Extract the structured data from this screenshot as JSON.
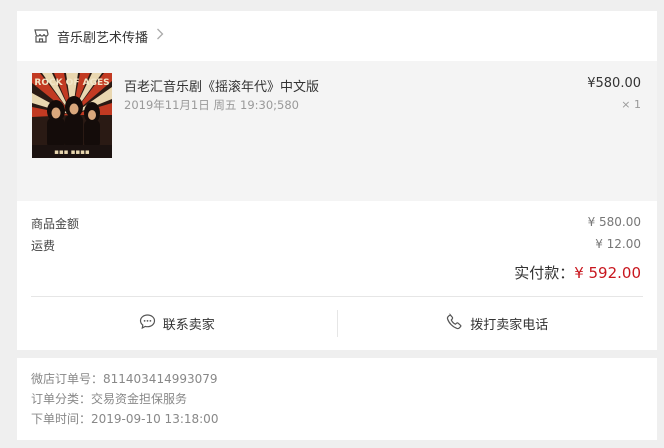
{
  "shop": {
    "name": "音乐剧艺术传播"
  },
  "product": {
    "title": "百老汇音乐剧《摇滚年代》中文版",
    "subtitle": "2019年11月1日 周五 19:30;580",
    "price": "¥580.00",
    "qty": "× 1",
    "poster_text": "ROCK OF AGES"
  },
  "summary": {
    "goods_label": "商品金额",
    "goods_value": "¥ 580.00",
    "shipping_label": "运费",
    "shipping_value": "¥ 12.00",
    "total_label": "实付款：",
    "total_value": "¥ 592.00"
  },
  "actions": {
    "contact_seller": "联系卖家",
    "call_seller": "拨打卖家电话"
  },
  "order_info": {
    "order_no": "微店订单号：811403414993079",
    "category": "订单分类：交易资金担保服务",
    "time": "下单时间：2019-09-10 13:18:00"
  },
  "colors": {
    "accent": "#c8161e",
    "background": "#efefef"
  }
}
